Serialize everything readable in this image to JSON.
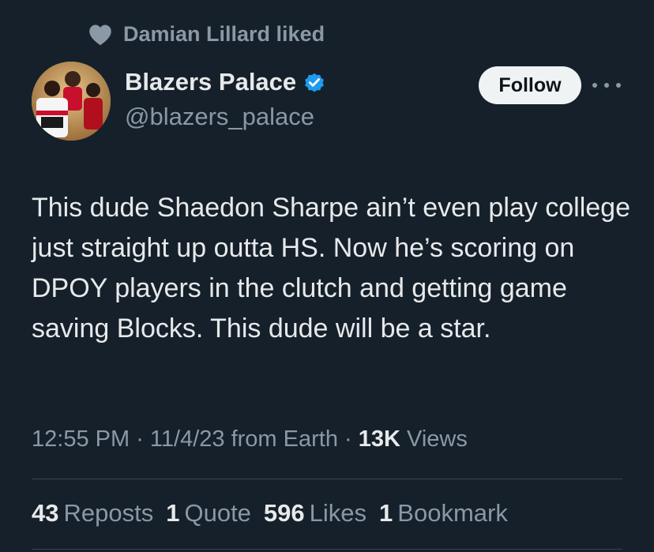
{
  "social_context": {
    "text": "Damian Lillard liked",
    "icon": "heart-icon"
  },
  "author": {
    "name": "Blazers Palace",
    "handle": "@blazers_palace",
    "verified_icon": "verified-badge-icon",
    "verified_color": "#1d9bf0"
  },
  "follow_button": {
    "label": "Follow"
  },
  "more_icon": "more-options-icon",
  "tweet": {
    "text": "This dude Shaedon Sharpe ain’t even play college just straight up outta HS. Now he’s scoring on DPOY players in the clutch and getting game saving Blocks. This dude will be a star."
  },
  "meta": {
    "time": "12:55 PM",
    "date": "11/4/23",
    "source": "from Earth",
    "views_count": "13K",
    "views_label": "Views"
  },
  "stats": {
    "reposts_count": "43",
    "reposts_label": "Reposts",
    "quotes_count": "1",
    "quotes_label": "Quote",
    "likes_count": "596",
    "likes_label": "Likes",
    "bookmarks_count": "1",
    "bookmarks_label": "Bookmark"
  },
  "colors": {
    "background": "#15202b",
    "primary_text": "#e7e9ea",
    "secondary_text": "#8b98a5",
    "divider": "#38444d"
  }
}
